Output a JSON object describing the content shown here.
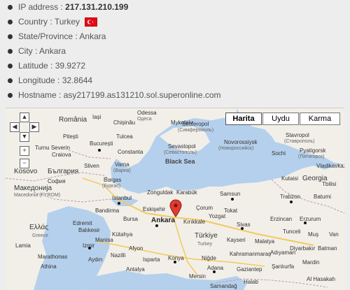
{
  "info": {
    "ip_label": "IP address : ",
    "ip_value": "217.131.210.199",
    "country_label": "Country : ",
    "country_value": "Turkey",
    "flag_icon": "turkey-flag-icon",
    "state_label": "State/Province : ",
    "state_value": "Ankara",
    "city_label": "City : ",
    "city_value": "Ankara",
    "lat_label": "Latitude : ",
    "lat_value": "39.9272",
    "lon_label": "Longitude : ",
    "lon_value": "32.8644",
    "host_label": "Hostname : ",
    "host_value": "asy217199.as131210.sol.superonline.com"
  },
  "map": {
    "type_buttons": [
      "Harita",
      "Uydu",
      "Karma"
    ],
    "active_type": "Harita",
    "labels": {
      "odessa": "Odessa",
      "odesa": "Одеса",
      "romania": "România",
      "iasi": "Iași",
      "chisinau": "Chișinău",
      "pitesti": "Pitești",
      "bucuresti": "București",
      "tulcea": "Tulcea",
      "mykolaiv": "Mykolaiv",
      "turnu": "Turnu Severin",
      "craiova": "Craiova",
      "constanta": "Constanta",
      "simferopol": "Simferopol",
      "simferopol_cyr": "(Симферополь)",
      "sevastopol": "Sevastopol",
      "sevastopol_cyr": "(Севастополь)",
      "novorossiysk": "Novorossiysk",
      "novorossiysk_cyr": "(Новороссийск)",
      "stavropol": "Stavropol",
      "stavropol_cyr": "(Ставрополь)",
      "pyatigorsk": "Pyatigorsk",
      "pyatigorsk_cyr": "(Пятигорск)",
      "kosovo": "Kosovo",
      "bulgaria": "България",
      "sofia": "София",
      "sliven": "Sliven",
      "varna": "Varna",
      "varna_cyr": "(Варна)",
      "black_sea": "Black Sea",
      "sochi": "Sochi",
      "vladikavkaz": "Vladikavkaz",
      "georgia": "Georgia",
      "kutaisi": "Kutaisi",
      "tbilisi": "Tbilisi",
      "macedonia": "Македонија",
      "fyrom": "Macedonia (FYROM)",
      "burgas": "Burgas",
      "burgas_cyr": "(Бургас)",
      "zonguldak": "Zonguldak",
      "karabuk": "Karabük",
      "samsun": "Samsun",
      "trabzon": "Trabzon",
      "batumi": "Batumi",
      "istanbul": "Istanbul",
      "bandirma": "Bandirma",
      "bursa": "Bursa",
      "balikesir": "Balıkesir",
      "edremit": "Edremit",
      "corum": "Çorum",
      "tokat": "Tokat",
      "ankara": "Ankara",
      "kirikkale": "Kırıkkale",
      "yozgat": "Yozgat",
      "sivas": "Sivas",
      "erzincan": "Erzincan",
      "erzurum": "Erzurum",
      "ellas": "Ελλάς",
      "greece": "Greece",
      "kutahya": "Kütahya",
      "afyon": "Afyon",
      "eskisehir": "Eskişehir",
      "turkiye": "Türkiye",
      "turkey": "Turkey",
      "kayseri": "Kayseri",
      "malatya": "Malatya",
      "tunceli": "Tunceli",
      "mus": "Muş",
      "van": "Van",
      "izmir": "Izmir",
      "manisa": "Manisa",
      "isparta": "Isparta",
      "konya": "Konya",
      "nigde": "Niğde",
      "kahramanmaras": "Kahramanmaraş",
      "adiyaman": "Adıyaman",
      "diyarbakir": "Diyarbakır",
      "batman": "Batman",
      "nazilli": "Nazilli",
      "aydin": "Aydın",
      "adana": "Adana",
      "gaziantep": "Gaziantep",
      "sanliurfa": "Şanlıurfa",
      "mardin": "Mardin",
      "antalya": "Antalya",
      "mersin": "Mersin",
      "halab": "Halab",
      "al_hasakah": "Al Hasakah",
      "sanandaj": "Samandağ",
      "lamia": "Lamia",
      "marathonas": "Marathonas",
      "athina": "Athina"
    }
  }
}
